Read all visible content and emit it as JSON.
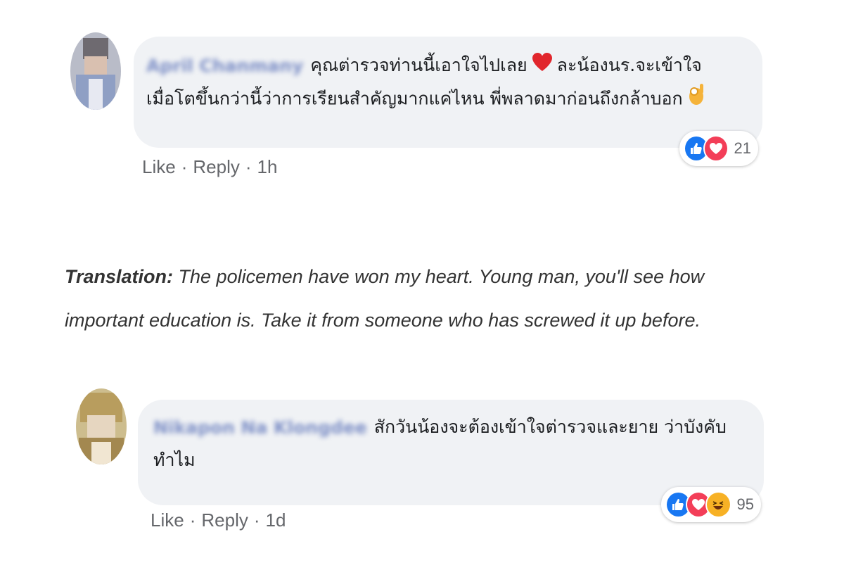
{
  "comments": [
    {
      "author": "April Chanmany",
      "text_line1": "คุณต่ารวจท่านนี้เอาใจไปเลย",
      "text_line1b": "ละน้องนร.จะเข้าใจ",
      "text_line2": "เมื่อโตขึ้นกว่านี้ว่าการเรียนสำคัญมากแค่ไหน พี่พลาดมาก่อนถึงกล้าบอก",
      "like_label": "Like",
      "reply_label": "Reply",
      "separator": "·",
      "time": "1h",
      "reaction_count": "21",
      "reactions": [
        "like-icon",
        "love-icon"
      ]
    },
    {
      "author": "Nikapon Na Klongdee",
      "text_line1": "สักวันน้องจะต้องเข้าใจต่ารวจและยาย ว่าบังคับ",
      "text_line2": "ทำไม",
      "like_label": "Like",
      "reply_label": "Reply",
      "separator": "·",
      "time": "1d",
      "reaction_count": "95",
      "reactions": [
        "like-icon",
        "love-icon",
        "haha-icon"
      ]
    }
  ],
  "translation": {
    "label": "Translation:",
    "text": " The policemen have won my heart. Young man, you'll see how important education is. Take it from someone who has screwed it up before."
  },
  "colors": {
    "like": "#1877f2",
    "love": "#f33e58",
    "haha": "#f7b125",
    "bubble": "#f0f2f5"
  }
}
